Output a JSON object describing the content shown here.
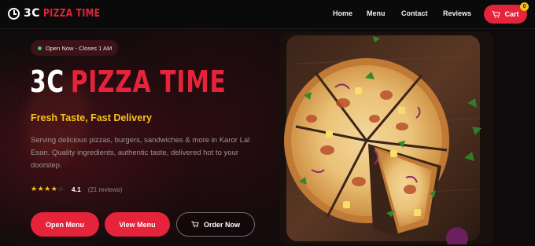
{
  "brand": {
    "prefix": "3C",
    "name": "PIZZA TIME",
    "logo_icon": "clock-icon",
    "accent_color": "#e5233b",
    "highlight_color": "#f7c21b"
  },
  "nav": {
    "links": [
      "Home",
      "Menu",
      "Contact",
      "Reviews"
    ],
    "cart_label": "Cart",
    "cart_count": "0"
  },
  "hero": {
    "status": "Open Now - Closes 1 AM",
    "headline_white": "3C",
    "headline_red": "PIZZA TIME",
    "tagline": "Fresh Taste, Fast Delivery",
    "description": "Serving delicious pizzas, burgers, sandwiches & more in Karor Lal Esan. Quality ingredients, authentic taste, delivered hot to your doorstep.",
    "rating_value": "4.1",
    "rating_stars": 4.1,
    "rating_count": "(21 reviews)",
    "buttons": {
      "open_menu": "Open Menu",
      "view_menu": "View Menu",
      "order_now": "Order Now"
    }
  }
}
